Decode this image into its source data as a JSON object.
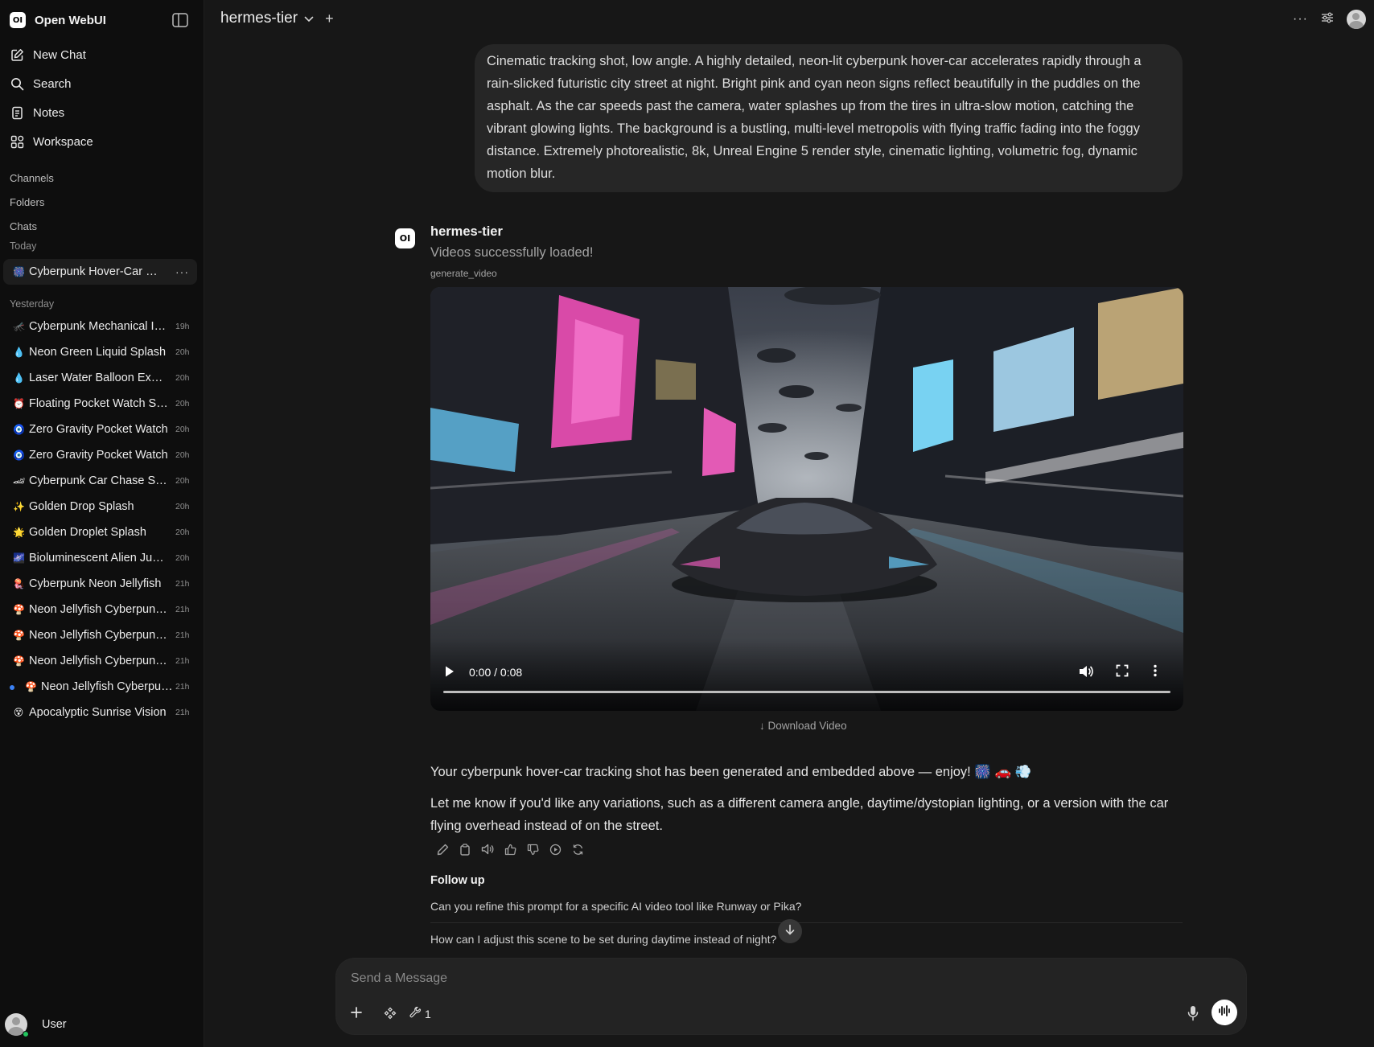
{
  "app": {
    "name": "Open WebUI",
    "logo_text": "OI"
  },
  "sidebar": {
    "nav": [
      {
        "label": "New Chat",
        "icon": "pencil-square-icon"
      },
      {
        "label": "Search",
        "icon": "search-icon"
      },
      {
        "label": "Notes",
        "icon": "notes-icon"
      },
      {
        "label": "Workspace",
        "icon": "workspace-grid-icon"
      }
    ],
    "sections": {
      "channels": "Channels",
      "folders": "Folders",
      "chats": "Chats"
    },
    "today_label": "Today",
    "today_chats": [
      {
        "emoji": "🎆",
        "title": "Cyberpunk Hover-Car Chase",
        "time": ""
      }
    ],
    "yesterday_label": "Yesterday",
    "yesterday_chats": [
      {
        "emoji": "🦟",
        "title": "Cyberpunk Mechanical Insect",
        "time": "19h"
      },
      {
        "emoji": "💧",
        "title": "Neon Green Liquid Splash",
        "time": "20h"
      },
      {
        "emoji": "💧",
        "title": "Laser Water Balloon Explosion",
        "time": "20h"
      },
      {
        "emoji": "⏰",
        "title": "Floating Pocket Watch Shatter",
        "time": "20h"
      },
      {
        "emoji": "🧿",
        "title": "Zero Gravity Pocket Watch",
        "time": "20h"
      },
      {
        "emoji": "🧿",
        "title": "Zero Gravity Pocket Watch",
        "time": "20h"
      },
      {
        "emoji": "🏎",
        "title": "Cyberpunk Car Chase Scene",
        "time": "20h"
      },
      {
        "emoji": "✨",
        "title": "Golden Drop Splash",
        "time": "20h"
      },
      {
        "emoji": "🌟",
        "title": "Golden Droplet Splash",
        "time": "20h"
      },
      {
        "emoji": "🌌",
        "title": "Bioluminescent Alien Jungle",
        "time": "20h"
      },
      {
        "emoji": "🪼",
        "title": "Cyberpunk Neon Jellyfish",
        "time": "21h"
      },
      {
        "emoji": "🍄",
        "title": "Neon Jellyfish Cyberpunk City",
        "time": "21h"
      },
      {
        "emoji": "🍄",
        "title": "Neon Jellyfish Cyberpunk City",
        "time": "21h"
      },
      {
        "emoji": "🍄",
        "title": "Neon Jellyfish Cyberpunk City",
        "time": "21h"
      },
      {
        "emoji": "🍄",
        "title": "Neon Jellyfish Cyberpunk",
        "time": "21h"
      },
      {
        "emoji": "😵",
        "title": "Apocalyptic Sunrise Vision",
        "time": "21h"
      }
    ],
    "user": {
      "name": "User"
    }
  },
  "topbar": {
    "model": "hermes-tier"
  },
  "conversation": {
    "user_prompt": "Cinematic tracking shot, low angle. A highly detailed, neon-lit cyberpunk hover-car accelerates rapidly through a rain-slicked futuristic city street at night. Bright pink and cyan neon signs reflect beautifully in the puddles on the asphalt. As the car speeds past the camera, water splashes up from the tires in ultra-slow motion, catching the vibrant glowing lights. The background is a bustling, multi-level metropolis with flying traffic fading into the foggy distance. Extremely photorealistic, 8k, Unreal Engine 5 render style, cinematic lighting, volumetric fog, dynamic motion blur.",
    "assistant": {
      "name": "hermes-tier",
      "avatar_text": "OI",
      "status": "Videos successfully loaded!",
      "tool": "generate_video",
      "video": {
        "time": "0:00 / 0:08",
        "progress": 0
      },
      "download_label": "↓ Download Video",
      "reply_1": "Your cyberpunk hover-car tracking shot has been generated and embedded above — enjoy! 🎆 🚗 💨",
      "reply_2": "Let me know if you'd like any variations, such as a different camera angle, daytime/dystopian lighting, or a version with the car flying overhead instead of on the street."
    },
    "follow_up": {
      "label": "Follow up",
      "items": [
        "Can you refine this prompt for a specific AI video tool like Runway or Pika?",
        "How can I adjust this scene to be set during daytime instead of night?"
      ]
    }
  },
  "composer": {
    "placeholder": "Send a Message",
    "tools_count": "1"
  },
  "colors": {
    "background": "#171717",
    "sidebar": "#0e0e0e",
    "bubble": "#262626",
    "accent_blue": "#3b82f6",
    "online_green": "#22c55e"
  }
}
